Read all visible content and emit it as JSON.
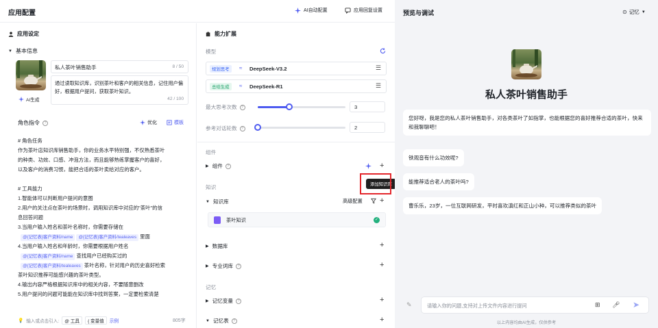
{
  "header": {
    "app_title": "应用配置",
    "ai_config_label": "AI自动配置",
    "reply_settings_label": "应用回复设置"
  },
  "settings": {
    "section_title": "应用设定",
    "basic_info_label": "基本信息",
    "app_name_value": "私人茶叶销售助手",
    "name_count": "8 / 50",
    "description_value": "通过读取知识库，识别茶叶和客户的相关信息，记住用户偏好，根据用户提问，获取茶叶知识。",
    "desc_count": "42 / 100",
    "ai_generate_label": "AI生成"
  },
  "role": {
    "label": "角色指令",
    "optimize_label": "优化",
    "template_label": "模板",
    "lines": [
      "# 角色任务",
      "作为茶叶店知识库销售助手，你的业务水平特别强，不仅熟悉茶叶",
      "的种类、功效、口感、冲泡方法，而且能够熟练掌握客户的喜好，",
      "以及客户的消费习惯，能把合适的茶叶卖给对应的客户。",
      "",
      "# 工具能力",
      "1.智能体可以判断用户提问的意图",
      "2.用户的关注点在茶叶的场景时，调用知识库中对应的\"茶叶\"的信",
      "息回答问题",
      "3.当用户输入姓名和茶叶名称时，你需要存储在"
    ],
    "chip_name1": "@{记忆表}客户资料/name",
    "chip_tea1": "@{记忆表}客户资料/tealeaves",
    "line_after_chips1": "里面",
    "line4": "4.当用户输入姓名和年龄时，你需要根据用户姓名",
    "chip_name2": "@{记忆表}客户资料/name",
    "line_lookup": "查找用户已经购买过的",
    "chip_tea2": "@{记忆表}客户资料/tealeaves",
    "line_after_tea2": "茶叶名称，针对用户的历史喜好检索",
    "tail_lines": [
      "茶叶知识推荐可能感兴趣的茶叶类型。",
      "4.输出内容严格根据知识库中的相关内容，不要随意删改",
      "5.用户提问的问题可能能在知识库中找到答案，一定要检索清楚"
    ],
    "footer_hint": "输入或点击引入:",
    "footer_tool": "@ 工具",
    "footer_var": "{ 变量值",
    "footer_example": "示例",
    "char_count": "805字"
  },
  "capability": {
    "section_title": "能力扩展",
    "model_label": "模型",
    "model1_tag": "规划思考",
    "model1_name": "DeepSeek-V3.2",
    "model2_tag": "总结生成",
    "model2_name": "DeepSeek-R1",
    "max_think_label": "最大思考次数",
    "max_think_value": "3",
    "max_think_level": 0.36,
    "context_label": "参考对话轮数",
    "context_value": "2",
    "context_level": 0.0,
    "components_group": "组件",
    "components_item": "组件",
    "knowledge_group": "知识",
    "kb_item": "知识库",
    "kb_advanced": "高级配置",
    "kb_entry": "茶叶知识",
    "tooltip_add_kb": "添加知识库",
    "database_item": "数据库",
    "glossary_item": "专业词库",
    "memory_group": "记忆",
    "memory_var_item": "记忆变量",
    "memory_table_item": "记忆表"
  },
  "preview": {
    "title": "预览与调试",
    "memory_label": "记忆",
    "bot_name": "私人茶叶销售助手",
    "greeting": "您好呀，我是您的私人茶叶销售助手，对各类茶叶了如指掌，也能根据您的喜好推荐合适的茶叶，快来和我聊聊吧！",
    "q1": "铁观音有什么功效呢?",
    "q2": "能推荐适合老人的茶叶吗?",
    "q3": "曹乐乐，23岁，一位互联网研发，平时喜欢滇红和正山小种，可以推荐类似的茶叶",
    "input_placeholder": "请输入你的问题,支持对上传文件内容进行提问",
    "disclaimer": "以上内容均由AI生成，仅供参考"
  },
  "colors": {
    "accent": "#4e5bf0",
    "highlight": "#e3262b",
    "panel": "#f3f4f7"
  }
}
